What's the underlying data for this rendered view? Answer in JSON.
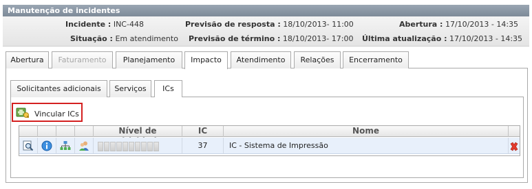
{
  "header": {
    "title": "Manutenção de incidentes"
  },
  "info": {
    "incidente_label": "Incidente :",
    "incidente_value": "INC-448",
    "previsao_resposta_label": "Previsão de resposta :",
    "previsao_resposta_value": "18/10/2013- 11:00",
    "abertura_label": "Abertura :",
    "abertura_value": "17/10/2013 - 14:35",
    "situacao_label": "Situação :",
    "situacao_value": "Em atendimento",
    "previsao_termino_label": "Previsão de término :",
    "previsao_termino_value": "18/10/2013- 17:00",
    "ultima_atualizacao_label": "Última atualização :",
    "ultima_atualizacao_value": "17/10/2013 - 14:35"
  },
  "main_tabs": [
    {
      "label": "Abertura"
    },
    {
      "label": "Faturamento"
    },
    {
      "label": "Planejamento"
    },
    {
      "label": "Impacto"
    },
    {
      "label": "Atendimento"
    },
    {
      "label": "Relações"
    },
    {
      "label": "Encerramento"
    }
  ],
  "sub_tabs": [
    {
      "label": "Solicitantes adicionais"
    },
    {
      "label": "Serviços"
    },
    {
      "label": "ICs"
    }
  ],
  "toolbar": {
    "vincular_label": "Vincular ICs"
  },
  "grid": {
    "headers": {
      "criticidade": "Nível de criticidade",
      "ic": "IC",
      "nome": "Nome"
    },
    "rows": [
      {
        "ic": "37",
        "nome": "IC - Sistema de Impressão",
        "criticidade_level": 0
      }
    ]
  },
  "colors": {
    "title_bar": "#8a96a4",
    "highlight_border": "#d42020",
    "row_bg": "#e8f0fb"
  },
  "icons": [
    "add-ic-icon",
    "view-icon",
    "info-icon",
    "hierarchy-icon",
    "users-icon",
    "delete-icon"
  ]
}
